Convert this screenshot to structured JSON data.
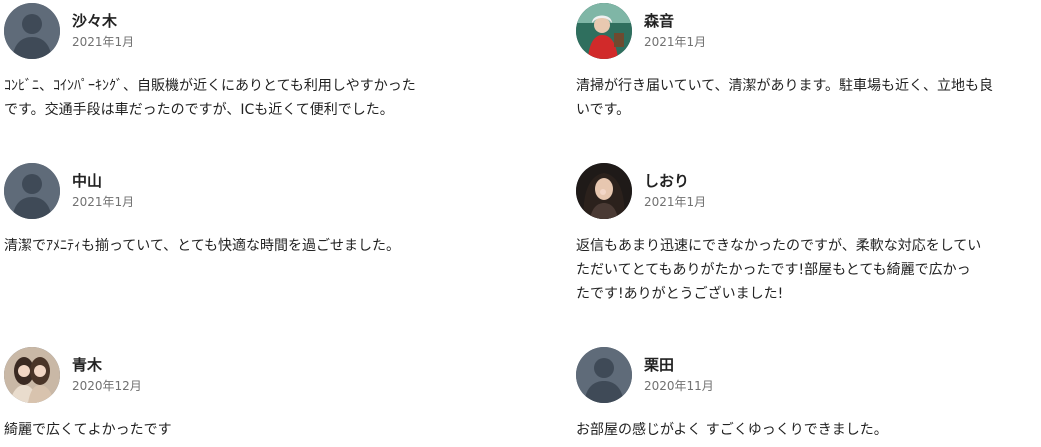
{
  "reviews": [
    {
      "name": "沙々木",
      "date": "2021年1月",
      "text": "ｺﾝﾋﾞﾆ、ｺｲﾝﾊﾟｰｷﾝｸﾞ、自販機が近くにありとても利用しやすかった\nです。交通手段は車だったのですが、ICも近くて便利でした。",
      "avatar": "default-person"
    },
    {
      "name": "森音",
      "date": "2021年1月",
      "text": "清掃が行き届いていて、清潔があります。駐車場も近く、立地も良\nいです。",
      "avatar": "photo"
    },
    {
      "name": "中山",
      "date": "2021年1月",
      "text": "清潔でｱﾒﾆﾃｨも揃っていて、とても快適な時間を過ごせました。",
      "avatar": "default-person"
    },
    {
      "name": "しおり",
      "date": "2021年1月",
      "text": "返信もあまり迅速にできなかったのですが、柔軟な対応をしてい\nただいてとてもありがたかったです!部屋もとても綺麗で広かっ\nたです!ありがとうございました!",
      "avatar": "photo"
    },
    {
      "name": "青木",
      "date": "2020年12月",
      "text": "綺麗で広くてよかったです",
      "avatar": "photo"
    },
    {
      "name": "栗田",
      "date": "2020年11月",
      "text": "お部屋の感じがよく すごくゆっくりできました。",
      "avatar": "default-person"
    }
  ],
  "colors": {
    "avatar_bg": "#5f6b79",
    "avatar_figure": "#3f4a57",
    "date": "#717171",
    "text": "#222222"
  }
}
